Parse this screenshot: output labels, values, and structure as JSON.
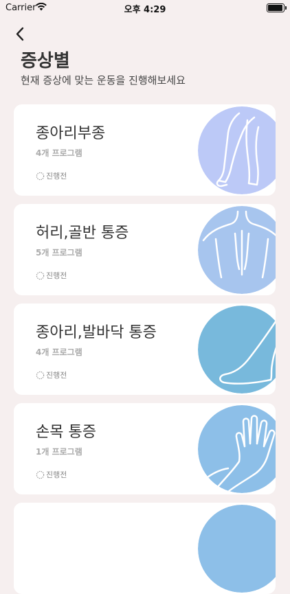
{
  "status_bar": {
    "carrier": "Carrier",
    "time": "오후 4:29"
  },
  "header": {
    "back_icon": "chevron-left-icon",
    "title": "증상별",
    "subtitle": "현재 증상에 맞는 운동을 진행해보세요"
  },
  "cards": [
    {
      "title": "종아리부종",
      "count": "4개 프로그램",
      "status": "진행전",
      "icon": "leg-icon",
      "color": "#bcc9f7"
    },
    {
      "title": "허리,골반 통증",
      "count": "5개 프로그램",
      "status": "진행전",
      "icon": "back-icon",
      "color": "#a7c5ee"
    },
    {
      "title": "종아리,발바닥 통증",
      "count": "4개 프로그램",
      "status": "진행전",
      "icon": "foot-icon",
      "color": "#78b9dc"
    },
    {
      "title": "손목 통증",
      "count": "1개 프로그램",
      "status": "진행전",
      "icon": "hand-icon",
      "color": "#8dbfe8"
    }
  ]
}
